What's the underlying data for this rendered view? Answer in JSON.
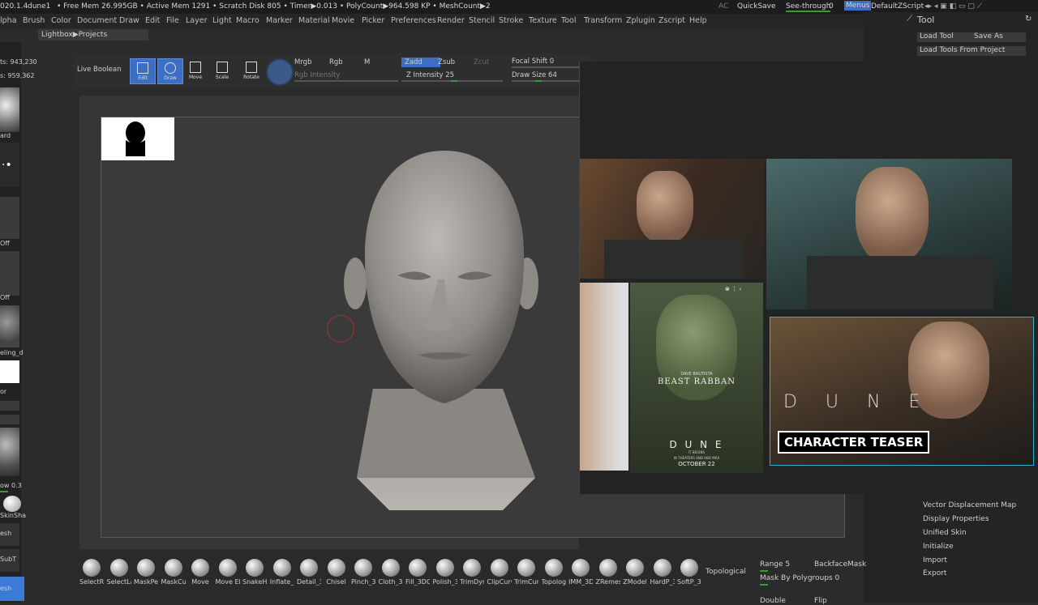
{
  "status": {
    "version": "020.1.4",
    "doc": "dune1",
    "free_mem": "• Free Mem 26.995GB • Active Mem 1291 • Scratch Disk 805 • Timer▶0.013 • PolyCount▶964.598 KP • MeshCount▶2",
    "ac": "AC",
    "quicksave": "QuickSave",
    "see_through": "See-through",
    "see_through_value": "0",
    "menus": "Menus",
    "default_script": "DefaultZScript"
  },
  "menu": [
    "lpha",
    "Brush",
    "Color",
    "Document",
    "Draw",
    "Edit",
    "File",
    "Layer",
    "Light",
    "Macro",
    "Marker",
    "Material",
    "Movie",
    "Picker",
    "Preferences",
    "Render",
    "Stencil",
    "Stroke",
    "Texture",
    "Tool",
    "Transform",
    "Zplugin",
    "Zscript",
    "Help"
  ],
  "lightbox": "Lightbox▶Projects",
  "left": {
    "points": "ts: 943,230",
    "points2": "s: 959,362",
    "labels": [
      "ard",
      "Off",
      "Off",
      "eling_d",
      "or",
      "ow 0.3",
      "SkinSha",
      "esh",
      "SubT",
      "esh"
    ]
  },
  "toolbar": {
    "live_boolean": "Live Boolean",
    "edit": "Edit",
    "draw": "Draw",
    "move": "Move",
    "scale": "Scale",
    "rotate": "Rotate",
    "mrgb": "Mrgb",
    "rgb": "Rgb",
    "m": "M",
    "rgb_intensity": "Rgb Intensity",
    "zadd": "Zadd",
    "zsub": "Zsub",
    "zcut": "Zcut",
    "z_intensity": "Z Intensity 25",
    "focal_shift": "Focal Shift 0",
    "draw_size": "Draw Size 64"
  },
  "tool_panel": {
    "title": "Tool",
    "load_tool": "Load Tool",
    "save_as": "Save As",
    "load_tools_from_project": "Load Tools From Project",
    "items": [
      "Vector Displacement Map",
      "Display Properties",
      "Unified Skin",
      "Initialize",
      "Import",
      "Export"
    ],
    "range": "Range 5",
    "backface_mask": "BackfaceMask",
    "mask_by_polygroups": "Mask By Polygroups 0",
    "double": "Double",
    "flip": "Flip",
    "topological": "Topological"
  },
  "reference": {
    "poster_credit": "DAVE BAUTISTA",
    "poster_name": "BEAST RABBAN",
    "poster_title": "D U N E",
    "poster_sub": "IT BEGINS",
    "poster_date": "OCTOBER 22",
    "poster_theaters": "IN THEATERS AND HBO MAX",
    "teaser_title": "D U N E",
    "teaser_label": "CHARACTER TEASER"
  },
  "brushes": [
    "SelectRe",
    "SelectLa",
    "MaskPe",
    "MaskCu",
    "Move",
    "Move El",
    "SnakeH",
    "Inflate_",
    "Detail_3",
    "Chisel",
    "Pinch_3D",
    "Cloth_3D",
    "Fill_3DC",
    "Polish_3",
    "TrimDyr",
    "ClipCurv",
    "TrimCur",
    "Topolog",
    "IMM_3D",
    "ZRemes",
    "ZModel",
    "HardP_3",
    "SoftP_3E"
  ]
}
